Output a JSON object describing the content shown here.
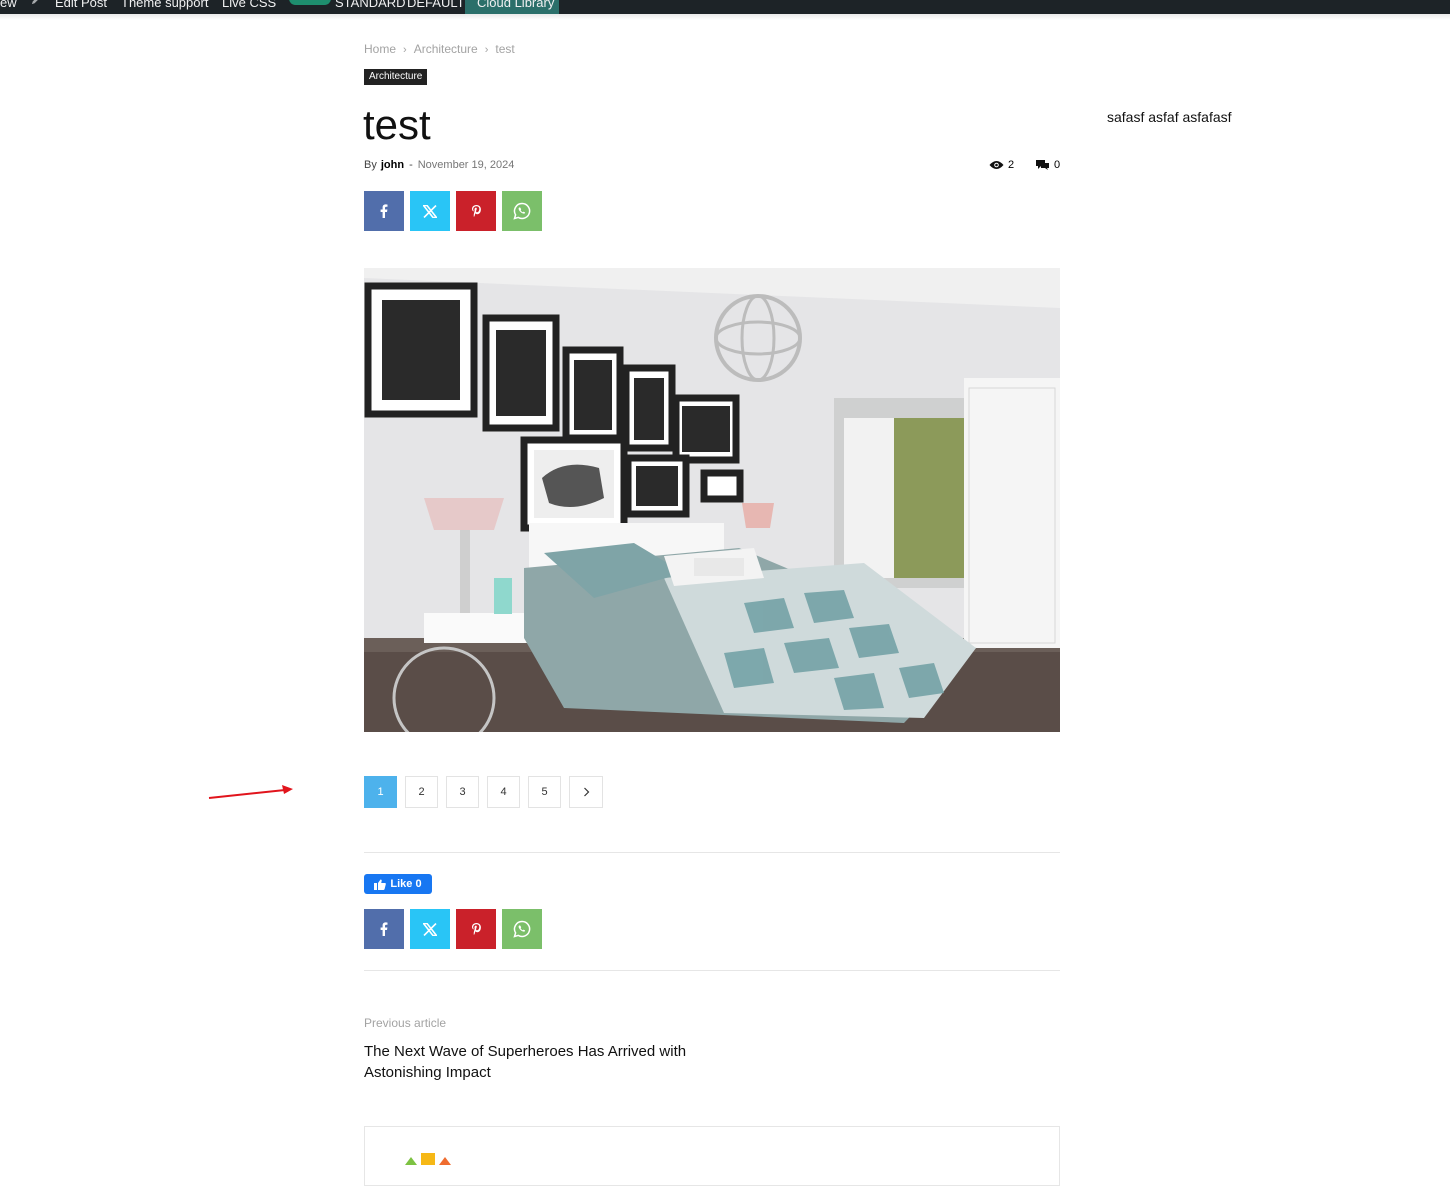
{
  "adminbar": {
    "new_label": "ew",
    "edit_label": "Edit Post",
    "support_label": "Theme support",
    "livecss_label": "Live CSS",
    "mode_label": "STANDARD",
    "default_label": "DEFAULT",
    "cloud_label": "Cloud Library"
  },
  "breadcrumb": {
    "home": "Home",
    "category": "Architecture",
    "current": "test",
    "separator": "›"
  },
  "post": {
    "category": "Architecture",
    "title": "test",
    "by": "By",
    "author": "john",
    "dash": "-",
    "date": "November 19, 2024",
    "views": "2",
    "comments": "0"
  },
  "sidebar": {
    "text": "safasf asfaf asfafasf"
  },
  "pagination": {
    "pages": [
      "1",
      "2",
      "3",
      "4",
      "5"
    ],
    "active": "1",
    "next_icon": "chevron-right-icon"
  },
  "social": {
    "like_label": "Like 0"
  },
  "navigation": {
    "prev_label": "Previous article",
    "prev_title": "The Next Wave of Superheroes Has Arrived with Astonishing Impact"
  },
  "colors": {
    "accent": "#4db2ec",
    "facebook": "#516eab",
    "twitter": "#29c5f6",
    "pinterest": "#ca212a",
    "whatsapp": "#7bbf6a"
  }
}
